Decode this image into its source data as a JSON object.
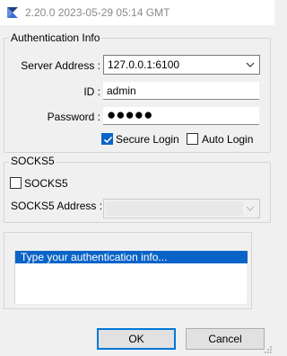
{
  "window": {
    "title": "2.20.0 2023-05-29 05:14 GMT"
  },
  "auth": {
    "group_title": "Authentication Info",
    "server_label": "Server Address :",
    "server_value": "127.0.0.1:6100",
    "id_label": "ID :",
    "id_value": "admin",
    "password_label": "Password :",
    "password_mask": "●●●●●",
    "secure_login_label": "Secure Login",
    "secure_login_checked": true,
    "auto_login_label": "Auto Login",
    "auto_login_checked": false
  },
  "socks": {
    "group_title": "SOCKS5",
    "checkbox_label": "SOCKS5",
    "checkbox_checked": false,
    "address_label": "SOCKS5 Address :",
    "address_value": ""
  },
  "info": {
    "text": "Type your authentication info..."
  },
  "buttons": {
    "ok_label": "OK",
    "cancel_label": "Cancel"
  },
  "colors": {
    "accent": "#0a64c8",
    "background": "#f0f0f0",
    "title_text": "#8a8a8a"
  }
}
